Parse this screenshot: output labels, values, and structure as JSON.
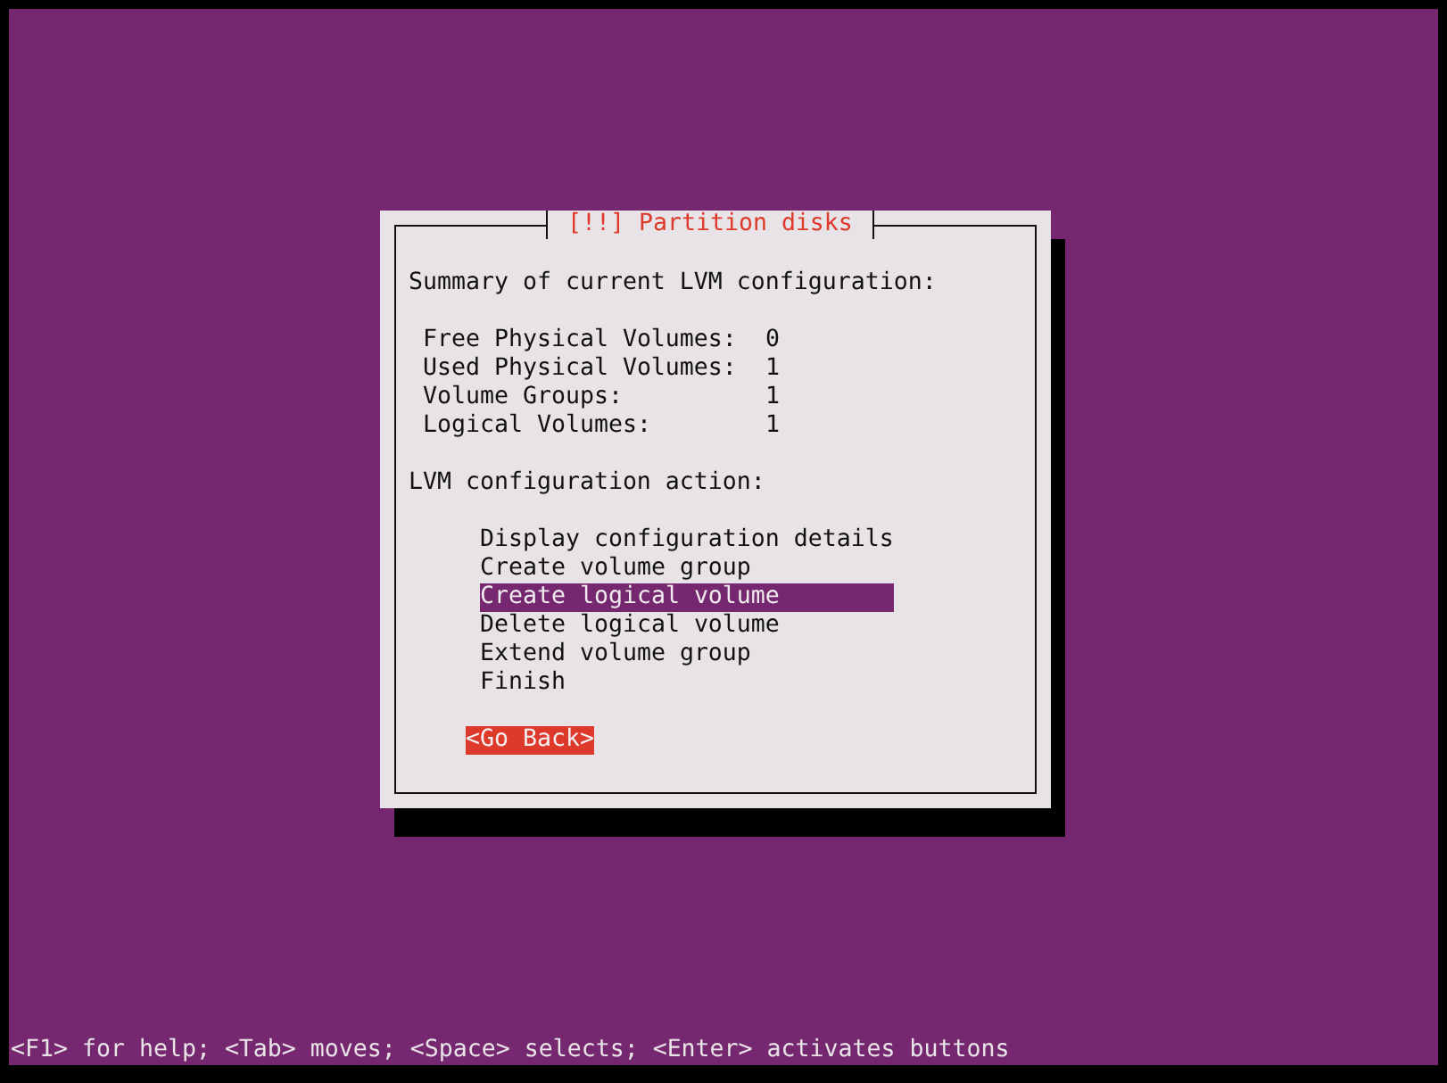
{
  "dialog": {
    "title": "[!!] Partition disks",
    "summary_heading": "Summary of current LVM configuration:",
    "summary": [
      {
        "label": "Free Physical Volumes:",
        "value": "0"
      },
      {
        "label": "Used Physical Volumes:",
        "value": "1"
      },
      {
        "label": "Volume Groups:",
        "value": "1"
      },
      {
        "label": "Logical Volumes:",
        "value": "1"
      }
    ],
    "action_heading": "LVM configuration action:",
    "actions": [
      {
        "label": "Display configuration details",
        "selected": false
      },
      {
        "label": "Create volume group",
        "selected": false
      },
      {
        "label": "Create logical volume",
        "selected": true
      },
      {
        "label": "Delete logical volume",
        "selected": false
      },
      {
        "label": "Extend volume group",
        "selected": false
      },
      {
        "label": "Finish",
        "selected": false
      }
    ],
    "button": {
      "label": "<Go Back>",
      "focused": true
    }
  },
  "status_bar": "<F1> for help; <Tab> moves; <Space> selects; <Enter> activates buttons"
}
